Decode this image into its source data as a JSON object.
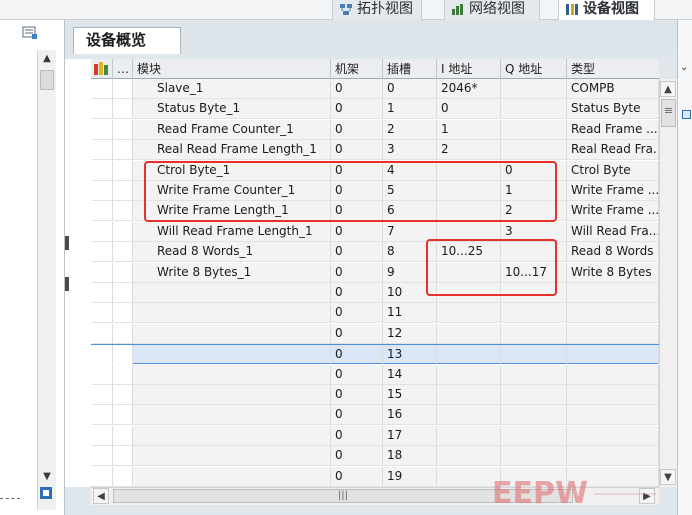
{
  "view_tabs": [
    {
      "label": "拓扑视图",
      "icon": "topology-icon",
      "active": false
    },
    {
      "label": "网络视图",
      "icon": "network-icon",
      "active": false
    },
    {
      "label": "设备视图",
      "icon": "device-icon",
      "active": true
    }
  ],
  "panel_tab": "设备概览",
  "columns": {
    "module": "模块",
    "rack": "机架",
    "slot": "插槽",
    "i_addr": "I 地址",
    "q_addr": "Q 地址",
    "type": "类型"
  },
  "rows": [
    {
      "module": "Slave_1",
      "rack": "0",
      "slot": "0",
      "i_addr": "2046*",
      "q_addr": "",
      "type": "COMPB"
    },
    {
      "module": "Status Byte_1",
      "rack": "0",
      "slot": "1",
      "i_addr": "0",
      "q_addr": "",
      "type": "Status Byte"
    },
    {
      "module": "Read Frame Counter_1",
      "rack": "0",
      "slot": "2",
      "i_addr": "1",
      "q_addr": "",
      "type": "Read Frame ..."
    },
    {
      "module": "Real Read Frame Length_1",
      "rack": "0",
      "slot": "3",
      "i_addr": "2",
      "q_addr": "",
      "type": "Real Read Fra..."
    },
    {
      "module": "Ctrol Byte_1",
      "rack": "0",
      "slot": "4",
      "i_addr": "",
      "q_addr": "0",
      "type": "Ctrol Byte"
    },
    {
      "module": "Write Frame Counter_1",
      "rack": "0",
      "slot": "5",
      "i_addr": "",
      "q_addr": "1",
      "type": "Write Frame ..."
    },
    {
      "module": "Write Frame Length_1",
      "rack": "0",
      "slot": "6",
      "i_addr": "",
      "q_addr": "2",
      "type": "Write Frame ..."
    },
    {
      "module": "Will Read Frame Length_1",
      "rack": "0",
      "slot": "7",
      "i_addr": "",
      "q_addr": "3",
      "type": "Will Read Fra..."
    },
    {
      "module": "Read 8 Words_1",
      "rack": "0",
      "slot": "8",
      "i_addr": "10...25",
      "q_addr": "",
      "type": "Read 8 Words"
    },
    {
      "module": "Write 8 Bytes_1",
      "rack": "0",
      "slot": "9",
      "i_addr": "",
      "q_addr": "10...17",
      "type": "Write 8 Bytes"
    },
    {
      "module": "",
      "rack": "0",
      "slot": "10",
      "i_addr": "",
      "q_addr": "",
      "type": ""
    },
    {
      "module": "",
      "rack": "0",
      "slot": "11",
      "i_addr": "",
      "q_addr": "",
      "type": ""
    },
    {
      "module": "",
      "rack": "0",
      "slot": "12",
      "i_addr": "",
      "q_addr": "",
      "type": ""
    },
    {
      "module": "",
      "rack": "0",
      "slot": "13",
      "i_addr": "",
      "q_addr": "",
      "type": ""
    },
    {
      "module": "",
      "rack": "0",
      "slot": "14",
      "i_addr": "",
      "q_addr": "",
      "type": ""
    },
    {
      "module": "",
      "rack": "0",
      "slot": "15",
      "i_addr": "",
      "q_addr": "",
      "type": ""
    },
    {
      "module": "",
      "rack": "0",
      "slot": "16",
      "i_addr": "",
      "q_addr": "",
      "type": ""
    },
    {
      "module": "",
      "rack": "0",
      "slot": "17",
      "i_addr": "",
      "q_addr": "",
      "type": ""
    },
    {
      "module": "",
      "rack": "0",
      "slot": "18",
      "i_addr": "",
      "q_addr": "",
      "type": ""
    },
    {
      "module": "",
      "rack": "0",
      "slot": "19",
      "i_addr": "",
      "q_addr": "",
      "type": ""
    }
  ],
  "selected_row_slot": "13",
  "watermark": "EEPW",
  "colors": {
    "highlight": "#e8302a",
    "selection": "#4f8edc"
  }
}
